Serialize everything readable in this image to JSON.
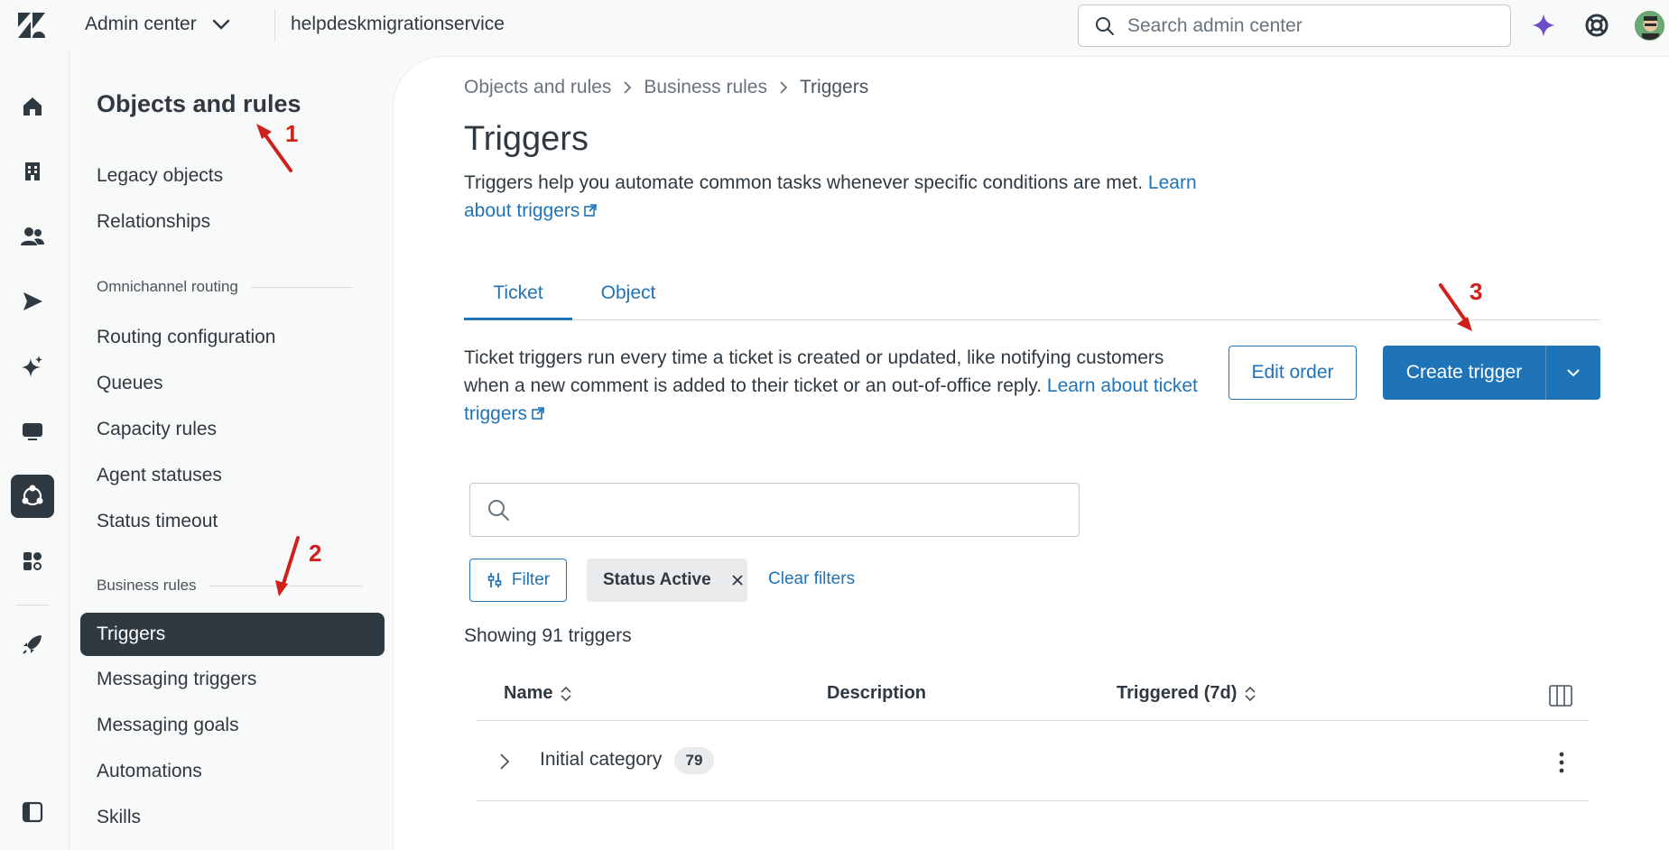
{
  "topbar": {
    "product": "Admin center",
    "account": "helpdeskmigrationservice",
    "search_placeholder": "Search admin center"
  },
  "icons": {
    "logo": "zendesk-logo-icon",
    "ai": "sparkle-icon",
    "help": "lifebuoy-icon",
    "avatar": "user-avatar"
  },
  "subnav": {
    "title": "Objects and rules",
    "items": [
      "Legacy objects",
      "Relationships"
    ],
    "section_omni": "Omnichannel routing",
    "omni_items": [
      "Routing configuration",
      "Queues",
      "Capacity rules",
      "Agent statuses",
      "Status timeout"
    ],
    "section_business": "Business rules",
    "business_items": [
      "Triggers",
      "Messaging triggers",
      "Messaging goals",
      "Automations",
      "Skills"
    ]
  },
  "breadcrumb": [
    "Objects and rules",
    "Business rules",
    "Triggers"
  ],
  "page": {
    "title": "Triggers",
    "description": "Triggers help you automate common tasks whenever specific conditions are met. ",
    "learn_link": "Learn about triggers"
  },
  "tabs": [
    "Ticket",
    "Object"
  ],
  "ticket": {
    "description": "Ticket triggers run every time a ticket is created or updated, like notifying customers when a new comment is added to their ticket or an out-of-office reply. ",
    "learn_link": "Learn about ticket triggers"
  },
  "buttons": {
    "edit_order": "Edit order",
    "create_trigger": "Create trigger",
    "filter": "Filter",
    "clear_filters": "Clear filters"
  },
  "filter_chip": "Status Active",
  "showing": "Showing 91 triggers",
  "table": {
    "headers": [
      "Name",
      "Description",
      "Triggered (7d)"
    ],
    "rows": [
      {
        "name": "Initial category",
        "count": "79"
      }
    ]
  },
  "annotations": [
    "1",
    "2",
    "3"
  ],
  "colors": {
    "accent": "#1f73b7",
    "dark": "#2f3941",
    "annotation": "#d0201c"
  }
}
